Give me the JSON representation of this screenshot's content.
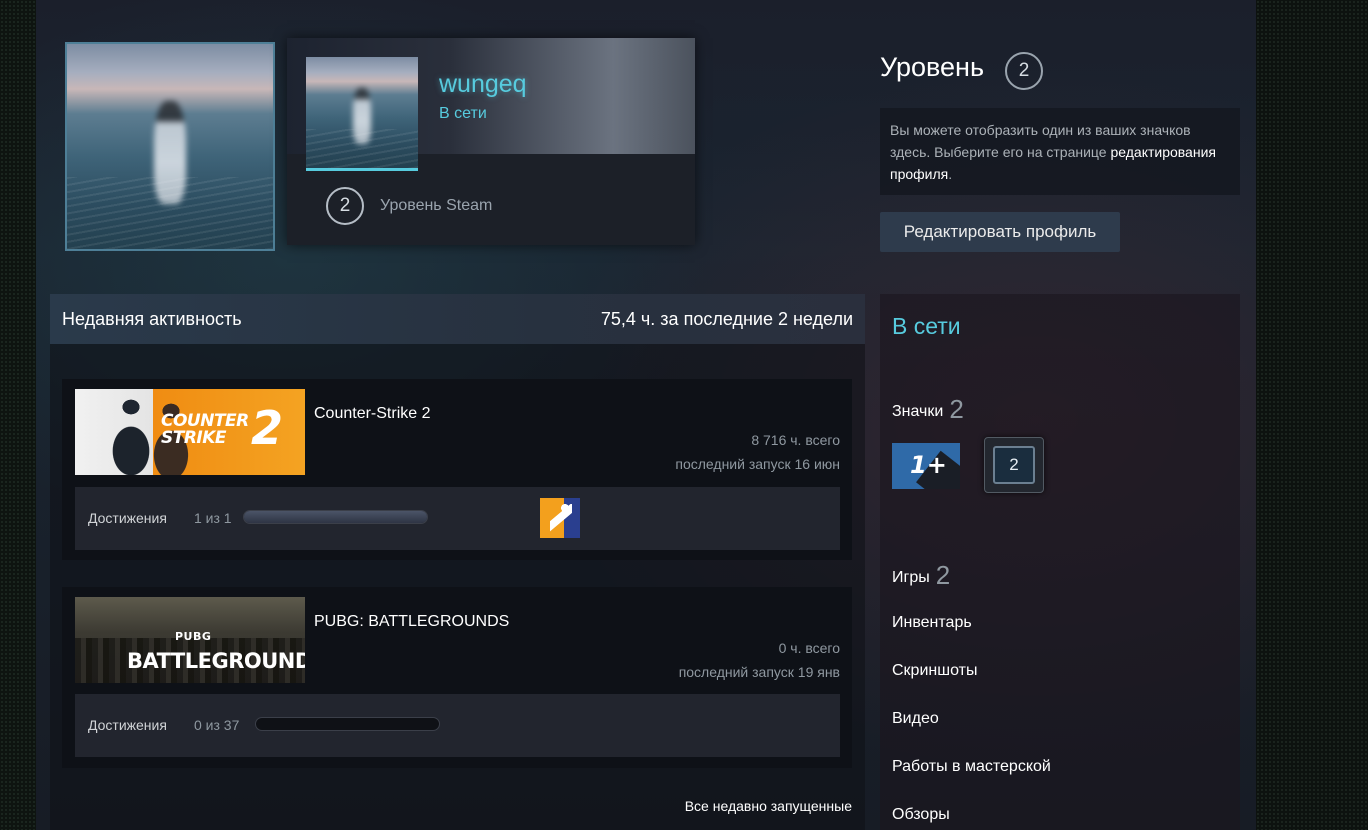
{
  "profile": {
    "name": "wungeq",
    "status": "В сети",
    "steam_level": "2",
    "steam_level_label": "Уровень Steam"
  },
  "level": {
    "title": "Уровень",
    "value": "2"
  },
  "badge_note": {
    "text": "Вы можете отобразить один из ваших значков здесь. Выберите его на странице",
    "link": "редактирования профиля",
    "end": "."
  },
  "edit_profile_label": "Редактировать профиль",
  "activity": {
    "title": "Недавняя активность",
    "summary": "75,4 ч. за последние 2 недели",
    "all_recent_label": "Все недавно запущенные",
    "games": [
      {
        "name": "Counter-Strike 2",
        "capsule_title": "COUNTER STRIKE",
        "capsule_number": "2",
        "hours": "8 716 ч. всего",
        "last_played": "последний запуск 16 июн",
        "achievements_label": "Достижения",
        "achievements": "1 из 1",
        "achievements_progress": 1.0
      },
      {
        "name": "PUBG: BATTLEGROUNDS",
        "capsule_small": "PUBG",
        "capsule_big": "BATTLEGROUNDS",
        "hours": "0 ч. всего",
        "last_played": "последний запуск 19 янв",
        "achievements_label": "Достижения",
        "achievements": "0 из 37",
        "achievements_progress": 0.0
      }
    ]
  },
  "sidebar": {
    "status": "В сети",
    "badges_label": "Значки",
    "badges_count": "2",
    "badge1_text": "1+",
    "badge2_text": "2",
    "games_label": "Игры",
    "games_count": "2",
    "links": [
      "Инвентарь",
      "Скриншоты",
      "Видео",
      "Работы в мастерской",
      "Обзоры"
    ]
  },
  "colors": {
    "accent": "#57cbde",
    "page_bg": "#1b2130",
    "panel_bg": "#0e1117"
  }
}
